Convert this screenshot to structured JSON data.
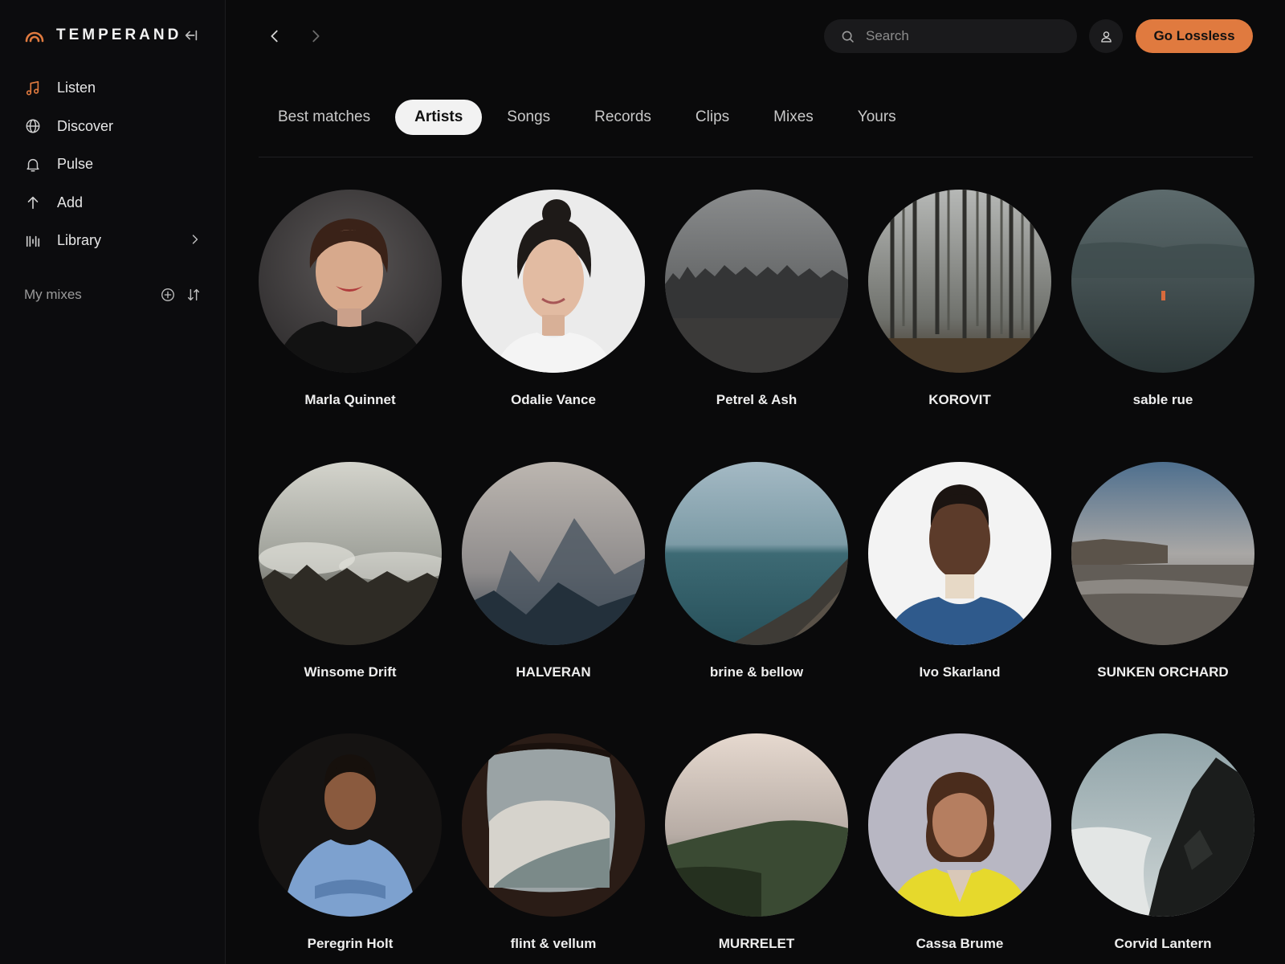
{
  "brand": {
    "name": "TEMPERAND"
  },
  "nav": {
    "items": [
      {
        "label": "Listen",
        "icon": "music-note-icon"
      },
      {
        "label": "Discover",
        "icon": "globe-icon"
      },
      {
        "label": "Pulse",
        "icon": "bell-icon"
      },
      {
        "label": "Add",
        "icon": "arrow-up-icon"
      },
      {
        "label": "Library",
        "icon": "library-icon"
      }
    ]
  },
  "my_mixes": {
    "title": "My mixes"
  },
  "search": {
    "placeholder": "Search"
  },
  "cta": {
    "label": "Go Lossless"
  },
  "tabs": [
    "Best matches",
    "Artists",
    "Songs",
    "Records",
    "Clips",
    "Mixes",
    "Yours"
  ],
  "artists": [
    "Marla Quinnet",
    "Odalie Vance",
    "Petrel & Ash",
    "KOROVIT",
    "sable rue",
    "Winsome Drift",
    "HALVERAN",
    "brine & bellow",
    "Ivo Skarland",
    "SUNKEN ORCHARD",
    "Peregrin Holt",
    "flint & vellum",
    "MURRELET",
    "Cassa Brume",
    "Corvid Lantern"
  ],
  "colors": {
    "accent": "#e07a3f",
    "background": "#0a0a0b",
    "sidebar": "#0c0c0e"
  }
}
